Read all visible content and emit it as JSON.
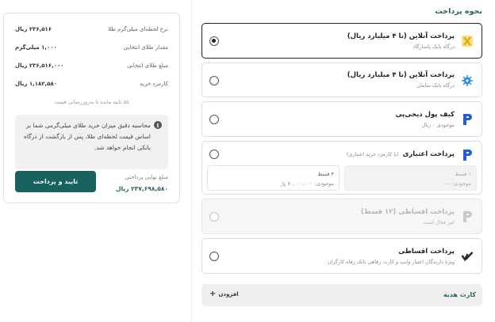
{
  "payment": {
    "title": "نحوه پرداخت",
    "options": [
      {
        "title": "پرداخت آنلاین (تا ۴ میلیارد ریال)",
        "subtitle": "درگاه بانک پاسارگاد",
        "icon": "pasargad-bank-icon",
        "selected": true
      },
      {
        "title": "پرداخت آنلاین (تا ۴ میلیارد ریال)",
        "subtitle": "درگاه بانک سامان",
        "icon": "saman-bank-icon",
        "selected": false
      },
      {
        "title": "کیف پول دیجی‌پی",
        "subtitle": "موجودی ۰ ریال",
        "icon": "digipay-icon",
        "selected": false
      },
      {
        "title": "پرداخت اعتباری",
        "title_note": "(با کارمزد خرید اعتباری)",
        "icon": "digipay-icon",
        "selected": false,
        "plans": [
          {
            "label": "۴ قسط",
            "balance": "موجودی: ۸۰,۰۰۰,۰۰۰ ﷼"
          },
          {
            "label": "۱ قسط",
            "balance": "موجودی: ---"
          }
        ]
      },
      {
        "title": "پرداخت اقساطی (۱۲ قسط)",
        "subtitle": "غیر فعال است",
        "icon": "digipay-icon",
        "selected": false,
        "disabled": true
      },
      {
        "title": "پرداخت اقساطی",
        "subtitle": "ویژهٔ دارندگان اعتبار وابپ و کارت رفاهی بانک رفاه کارگران",
        "icon": "checkmark-brand-icon",
        "selected": false
      }
    ],
    "gift_card": {
      "label": "کارت هدیه",
      "add_label": "افزودن",
      "add_icon": "plus-icon"
    }
  },
  "summary": {
    "rows": [
      {
        "label": "نرخ لحظه‌ای میلی‌گرم طلا",
        "value": "۲۳۶,۵۱۶ ریال"
      },
      {
        "label": "مقدار طلای انتخابی",
        "value": "۱,۰۰۰ میلی‌گرم"
      },
      {
        "label": "مبلغ طلای انتخابی",
        "value": "۲۳۶,۵۱۶,۰۰۰ ریال"
      },
      {
        "label": "کارمزد خرید",
        "value": "۱,۱۸۲,۵۸۰ ریال"
      }
    ],
    "timer": "۵۵ ثانیه مانده تا به‌روزرسانی قیمت",
    "note": "محاسبه دقیق میزان خرید طلای میلی‌گرمی شما بر اساس قیمت لحظه‌ای طلا، پس از بازگشت از درگاه بانکی انجام خواهد شد.",
    "note_icon": "info-icon",
    "confirm_label": "تایید و پرداخت",
    "final_label": "مبلغ نهایی پرداختی",
    "final_value": "۲۳۷,۶۹۸,۵۸۰ ریال"
  },
  "colors": {
    "accent": "#17615f",
    "title": "#2e5f63",
    "pasargad": "#f2c230",
    "saman": "#2a8fe0",
    "digipay": "#1d5fd6"
  }
}
